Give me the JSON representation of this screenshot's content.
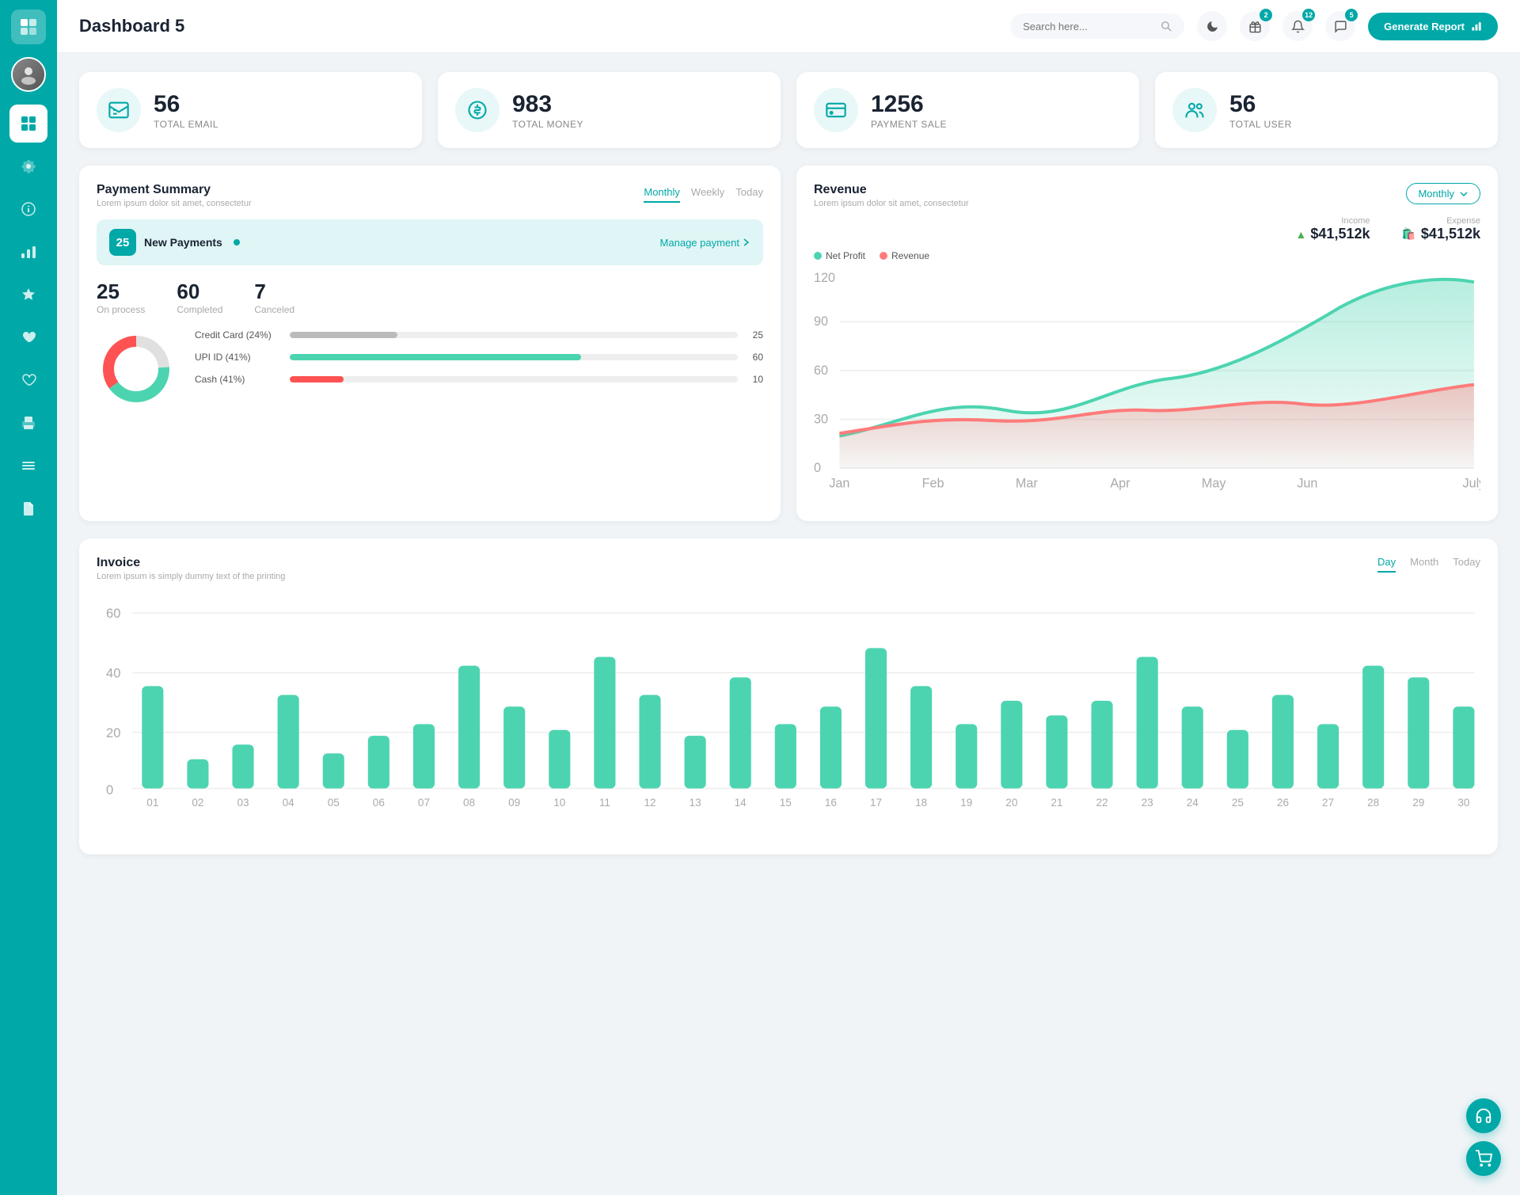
{
  "app": {
    "title": "Dashboard 5"
  },
  "header": {
    "search_placeholder": "Search here...",
    "generate_btn": "Generate Report",
    "badges": {
      "gift": "2",
      "bell": "12",
      "chat": "5"
    }
  },
  "stats": [
    {
      "id": "email",
      "icon": "📋",
      "number": "56",
      "label": "TOTAL EMAIL"
    },
    {
      "id": "money",
      "icon": "$",
      "number": "983",
      "label": "TOTAL MONEY"
    },
    {
      "id": "payment",
      "icon": "💳",
      "number": "1256",
      "label": "PAYMENT SALE"
    },
    {
      "id": "user",
      "icon": "👥",
      "number": "56",
      "label": "TOTAL USER"
    }
  ],
  "payment_summary": {
    "title": "Payment Summary",
    "subtitle": "Lorem ipsum dolor sit amet, consectetur",
    "tabs": [
      "Monthly",
      "Weekly",
      "Today"
    ],
    "active_tab": "Monthly",
    "new_payments_count": "25",
    "new_payments_label": "New Payments",
    "manage_link": "Manage payment",
    "stats": [
      {
        "num": "25",
        "label": "On process"
      },
      {
        "num": "60",
        "label": "Completed"
      },
      {
        "num": "7",
        "label": "Canceled"
      }
    ],
    "progress_bars": [
      {
        "label": "Credit Card (24%)",
        "value": 24,
        "color": "#bbb",
        "display": "25"
      },
      {
        "label": "UPI ID (41%)",
        "value": 65,
        "color": "#4cd4b0",
        "display": "60"
      },
      {
        "label": "Cash (41%)",
        "value": 12,
        "color": "#ff5252",
        "display": "10"
      }
    ],
    "donut": {
      "gray": 24,
      "green": 41,
      "red": 35
    }
  },
  "revenue": {
    "title": "Revenue",
    "subtitle": "Lorem ipsum dolor sit amet, consectetur",
    "dropdown": "Monthly",
    "income": {
      "label": "Income",
      "value": "$41,512k"
    },
    "expense": {
      "label": "Expense",
      "value": "$41,512k"
    },
    "legend": [
      {
        "label": "Net Profit",
        "color": "#4cd4b0"
      },
      {
        "label": "Revenue",
        "color": "#ff7b7b"
      }
    ],
    "x_labels": [
      "Jan",
      "Feb",
      "Mar",
      "Apr",
      "May",
      "Jun",
      "July"
    ],
    "y_labels": [
      "0",
      "30",
      "60",
      "90",
      "120"
    ]
  },
  "invoice": {
    "title": "Invoice",
    "subtitle": "Lorem ipsum is simply dummy text of the printing",
    "tabs": [
      "Day",
      "Month",
      "Today"
    ],
    "active_tab": "Day",
    "y_labels": [
      "0",
      "20",
      "40",
      "60"
    ],
    "x_labels": [
      "01",
      "02",
      "03",
      "04",
      "05",
      "06",
      "07",
      "08",
      "09",
      "10",
      "11",
      "12",
      "13",
      "14",
      "15",
      "16",
      "17",
      "18",
      "19",
      "20",
      "21",
      "22",
      "23",
      "24",
      "25",
      "26",
      "27",
      "28",
      "29",
      "30"
    ],
    "bars": [
      35,
      10,
      15,
      32,
      12,
      18,
      22,
      42,
      28,
      20,
      45,
      32,
      18,
      38,
      22,
      28,
      48,
      35,
      22,
      30,
      25,
      30,
      45,
      28,
      20,
      32,
      22,
      42,
      38,
      28
    ]
  },
  "sidebar": {
    "items": [
      {
        "id": "wallet",
        "icon": "👛",
        "active": false
      },
      {
        "id": "dashboard",
        "icon": "⊞",
        "active": true
      },
      {
        "id": "settings",
        "icon": "⚙",
        "active": false
      },
      {
        "id": "info",
        "icon": "ℹ",
        "active": false
      },
      {
        "id": "chart",
        "icon": "📊",
        "active": false
      },
      {
        "id": "star",
        "icon": "★",
        "active": false
      },
      {
        "id": "heart1",
        "icon": "♥",
        "active": false
      },
      {
        "id": "heart2",
        "icon": "♡",
        "active": false
      },
      {
        "id": "print",
        "icon": "🖨",
        "active": false
      },
      {
        "id": "list",
        "icon": "≡",
        "active": false
      },
      {
        "id": "docs",
        "icon": "📄",
        "active": false
      }
    ]
  },
  "fab": [
    {
      "id": "headset",
      "icon": "🎧"
    },
    {
      "id": "cart",
      "icon": "🛒"
    }
  ]
}
